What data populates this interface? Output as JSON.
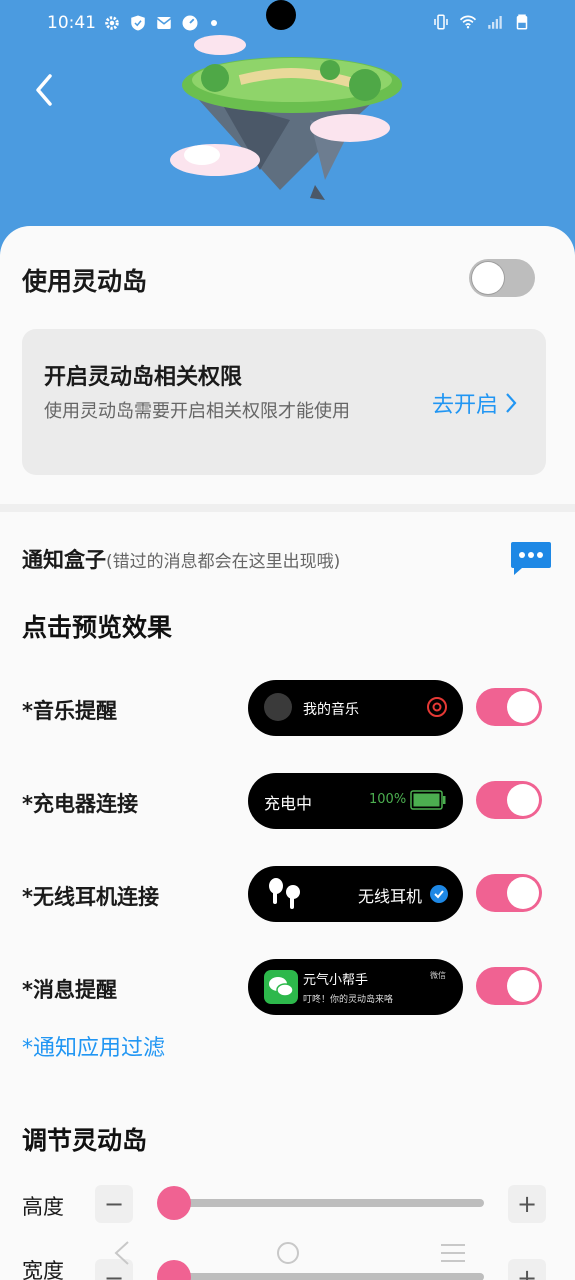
{
  "status_bar": {
    "time": "10:41"
  },
  "header": {
    "back_icon": "chevron-left-icon"
  },
  "use_island": {
    "label": "使用灵动岛",
    "enabled": false
  },
  "permission_card": {
    "title": "开启灵动岛相关权限",
    "description": "使用灵动岛需要开启相关权限才能使用",
    "action": "去开启"
  },
  "notification_box": {
    "title": "通知盒子",
    "subtitle": "(错过的消息都会在这里出现哦)"
  },
  "preview": {
    "title": "点击预览效果",
    "items": [
      {
        "label": "*音乐提醒",
        "pill_text": "我的音乐",
        "enabled": true
      },
      {
        "label": "*充电器连接",
        "pill_text": "充电中",
        "pill_value": "100%",
        "enabled": true
      },
      {
        "label": "*无线耳机连接",
        "pill_text": "无线耳机",
        "enabled": true
      },
      {
        "label": "*消息提醒",
        "pill_text": "元气小帮手",
        "pill_sub": "叮咚！你的灵动岛来咯",
        "pill_tag": "微信",
        "enabled": true
      }
    ],
    "filter_link": "*通知应用过滤"
  },
  "adjust": {
    "title": "调节灵动岛",
    "sliders": [
      {
        "label": "高度",
        "value": 0.0
      },
      {
        "label": "宽度",
        "value": 0.0
      }
    ],
    "minus": "−",
    "plus": "+"
  },
  "colors": {
    "accent": "#f06292",
    "link": "#2196f3",
    "header_bg": "#4b9be0"
  }
}
